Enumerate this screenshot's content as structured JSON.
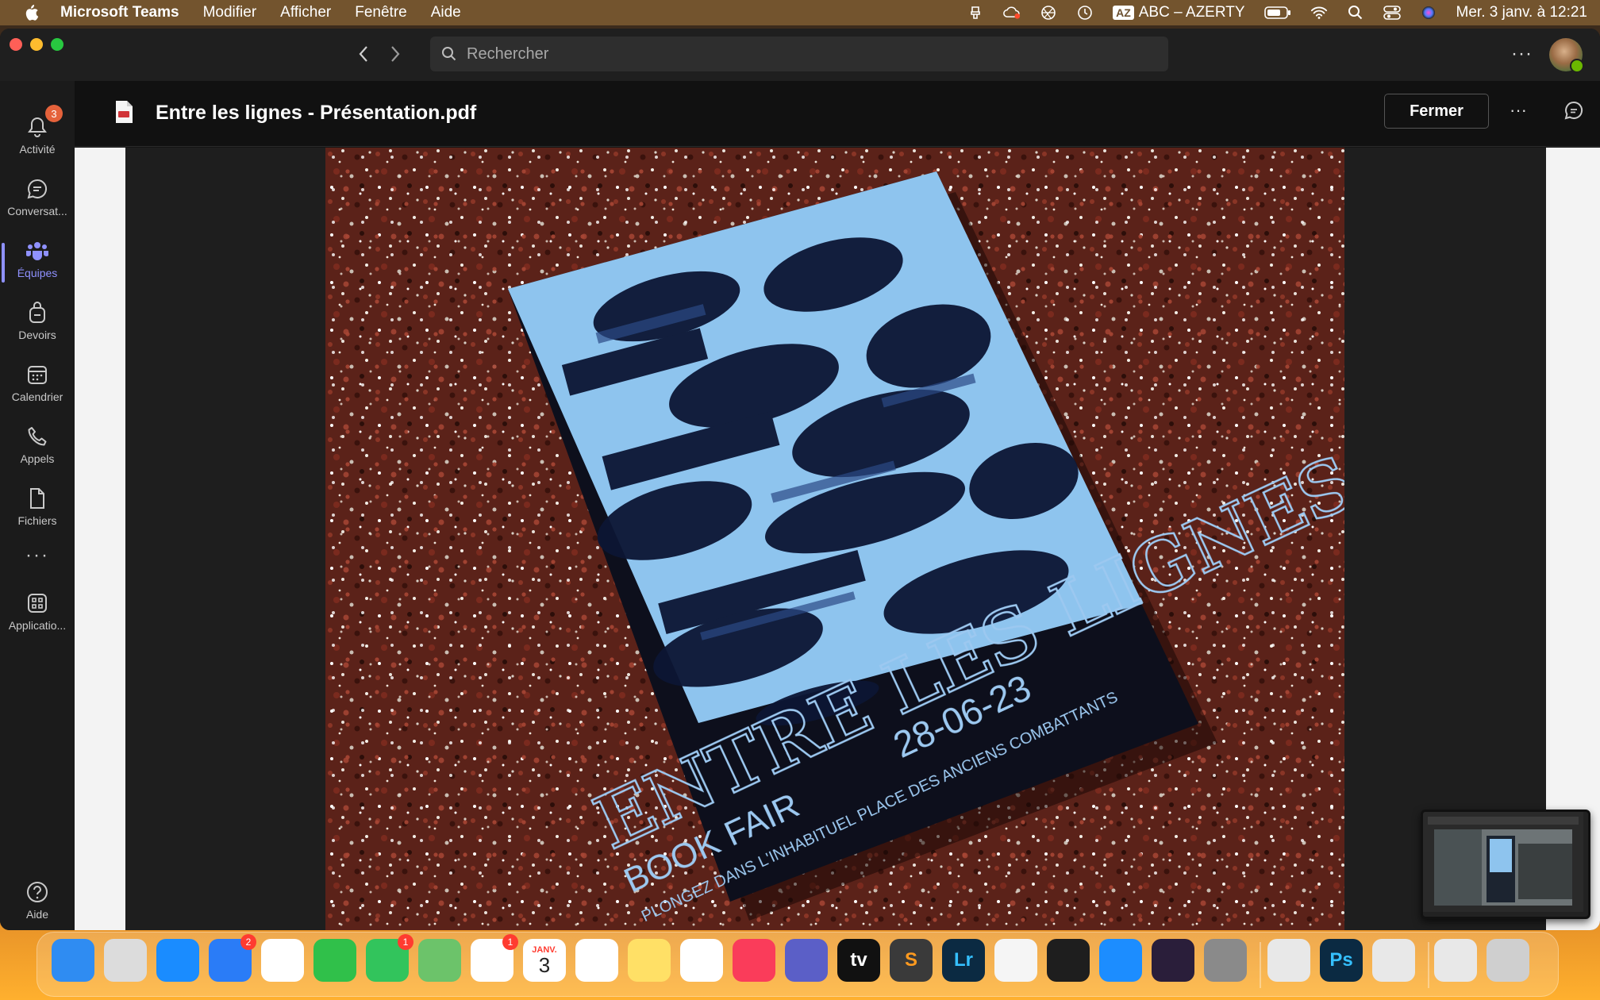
{
  "menubar": {
    "app_name": "Microsoft Teams",
    "menus": [
      "Modifier",
      "Afficher",
      "Fenêtre",
      "Aide"
    ],
    "keyboard_badge": "AZ",
    "keyboard_layout": "ABC – AZERTY",
    "datetime": "Mer. 3 janv. à 12:21"
  },
  "titlebar": {
    "search_placeholder": "Rechercher"
  },
  "rail": {
    "items": [
      {
        "label": "Activité",
        "icon": "bell-icon",
        "badge": "3"
      },
      {
        "label": "Conversat...",
        "icon": "chat-icon"
      },
      {
        "label": "Équipes",
        "icon": "teams-icon",
        "active": true
      },
      {
        "label": "Devoirs",
        "icon": "backpack-icon"
      },
      {
        "label": "Calendrier",
        "icon": "calendar-icon"
      },
      {
        "label": "Appels",
        "icon": "phone-icon"
      },
      {
        "label": "Fichiers",
        "icon": "file-icon"
      }
    ],
    "more": "···",
    "apps_label": "Applicatio...",
    "help_label": "Aide"
  },
  "file_header": {
    "title": "Entre les lignes - Présentation.pdf",
    "close_label": "Fermer",
    "more": "···"
  },
  "poster": {
    "title": "ENTRE LES LIGNES",
    "subtitle": "BOOK FAIR",
    "date": "28-06-23",
    "tagline": "PLONGEZ DANS L'INHABITUEL",
    "place": "PLACE DES ANCIENS COMBATTANTS"
  },
  "dock": {
    "apps": [
      {
        "name": "Finder",
        "icon": "finder-icon",
        "color": "#2f8cf2"
      },
      {
        "name": "Launchpad",
        "icon": "launchpad-icon",
        "color": "#dcdcdc"
      },
      {
        "name": "Safari",
        "icon": "safari-icon",
        "color": "#1a8cff"
      },
      {
        "name": "Mail",
        "icon": "mail-icon",
        "color": "#2a7cf7",
        "badge": "2"
      },
      {
        "name": "Chrome",
        "icon": "chrome-icon",
        "color": "#ffffff"
      },
      {
        "name": "FaceTime",
        "icon": "facetime-icon",
        "color": "#30c04a"
      },
      {
        "name": "Messages",
        "icon": "messages-icon",
        "color": "#32c45c",
        "badge": "1"
      },
      {
        "name": "Maps",
        "icon": "maps-icon",
        "color": "#6cc36a"
      },
      {
        "name": "Photos",
        "icon": "photos-icon",
        "color": "#ffffff",
        "badge": "1"
      },
      {
        "name": "Calendar",
        "icon": "calendar-app-icon",
        "color": "#ffffff",
        "month": "JANV.",
        "day": "3"
      },
      {
        "name": "Reminders",
        "icon": "reminders-icon",
        "color": "#ffffff"
      },
      {
        "name": "Notes",
        "icon": "notes-icon",
        "color": "#ffe066"
      },
      {
        "name": "Freeform",
        "icon": "freeform-icon",
        "color": "#ffffff"
      },
      {
        "name": "Music",
        "icon": "music-icon",
        "color": "#fa3c5a"
      },
      {
        "name": "Teams",
        "icon": "teams-app-icon",
        "color": "#5b5fc7"
      },
      {
        "name": "Apple TV",
        "icon": "appletv-icon",
        "color": "#111111",
        "label": "tv"
      },
      {
        "name": "Sublime",
        "icon": "sublime-icon",
        "color": "#3a3a3a",
        "label": "S"
      },
      {
        "name": "Lightroom",
        "icon": "lightroom-icon",
        "color": "#0b2a42",
        "label": "Lr"
      },
      {
        "name": "Blender",
        "icon": "blender-icon",
        "color": "#f5f5f5"
      },
      {
        "name": "Figma",
        "icon": "figma-icon",
        "color": "#1e1e1e"
      },
      {
        "name": "App Store",
        "icon": "appstore-icon",
        "color": "#1c8dff"
      },
      {
        "name": "Heart app",
        "icon": "heart-icon",
        "color": "#2a1e3a"
      },
      {
        "name": "System Settings",
        "icon": "settings-icon",
        "color": "#8a8a8a"
      },
      {
        "name": "CleanMyMac",
        "icon": "cleanmymac-icon",
        "color": "#e8e8e8"
      },
      {
        "name": "Photoshop",
        "icon": "photoshop-icon",
        "color": "#0b2a42",
        "label": "Ps"
      },
      {
        "name": "Preview",
        "icon": "preview-icon",
        "color": "#e8e8e8"
      },
      {
        "name": "Screenshot stack",
        "icon": "screenshot-stack-icon",
        "color": "#e8e8e8"
      },
      {
        "name": "Trash",
        "icon": "trash-icon",
        "color": "#cfcfcf"
      }
    ]
  }
}
